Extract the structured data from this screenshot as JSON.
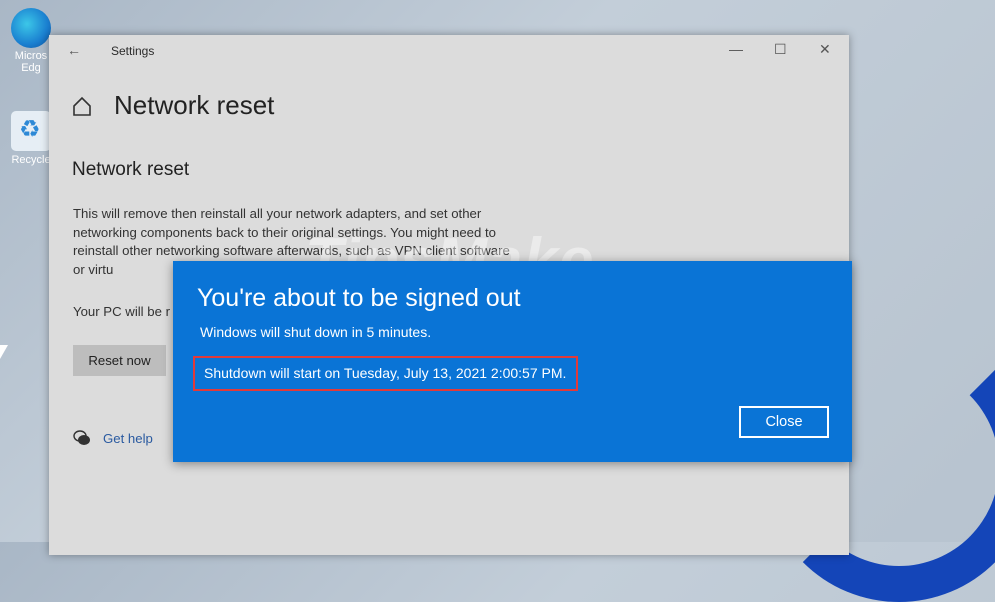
{
  "desktop": {
    "icons": [
      {
        "label": "Micros Edg"
      },
      {
        "label": "Recycle"
      }
    ]
  },
  "window": {
    "title": "Settings",
    "controls": {
      "minimize": "—",
      "maximize": "☐",
      "close": "✕"
    }
  },
  "page": {
    "title": "Network reset",
    "section_title": "Network reset",
    "description": "This will remove then reinstall all your network adapters, and set other networking components back to their original settings. You might need to reinstall other networking software afterwards, such as VPN client software or virtu",
    "pc_note": "Your PC will be r",
    "reset_button": "Reset now",
    "help_link": "Get help"
  },
  "watermark": {
    "main": "TipsMake",
    "suffix": ".com"
  },
  "dialog": {
    "title": "You're about to be signed out",
    "subtitle": "Windows will shut down in 5 minutes.",
    "shutdown_text": "Shutdown will start on Tuesday, July 13, 2021 2:00:57 PM.",
    "close_button": "Close"
  },
  "colors": {
    "dialog_bg": "#0a74d6",
    "highlight_border": "#e23a3a",
    "window_bg": "#dcdcdc",
    "link": "#2a5aa0"
  }
}
